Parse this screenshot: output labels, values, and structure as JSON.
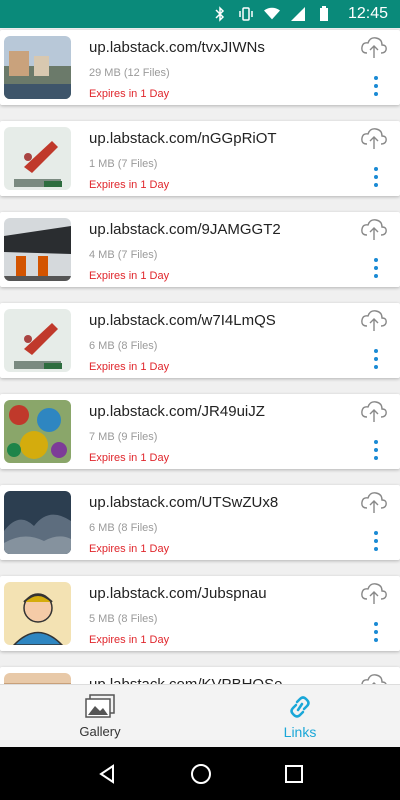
{
  "status": {
    "time": "12:45"
  },
  "links": [
    {
      "url": "up.labstack.com/tvxJIWNs",
      "meta": "29 MB (12 Files)",
      "expires": "Expires in 1 Day"
    },
    {
      "url": "up.labstack.com/nGGpRiOT",
      "meta": "1 MB (7 Files)",
      "expires": "Expires in 1 Day"
    },
    {
      "url": "up.labstack.com/9JAMGGT2",
      "meta": "4 MB (7 Files)",
      "expires": "Expires in 1 Day"
    },
    {
      "url": "up.labstack.com/w7I4LmQS",
      "meta": "6 MB (8 Files)",
      "expires": "Expires in 1 Day"
    },
    {
      "url": "up.labstack.com/JR49uiJZ",
      "meta": "7 MB (9 Files)",
      "expires": "Expires in 1 Day"
    },
    {
      "url": "up.labstack.com/UTSwZUx8",
      "meta": "6 MB (8 Files)",
      "expires": "Expires in 1 Day"
    },
    {
      "url": "up.labstack.com/Jubspnau",
      "meta": "5 MB (8 Files)",
      "expires": "Expires in 1 Day"
    },
    {
      "url": "up.labstack.com/KVPBHQSe",
      "meta": "",
      "expires": ""
    }
  ],
  "nav": {
    "gallery": "Gallery",
    "links": "Links"
  },
  "colors": {
    "accent": "#1aa7d8",
    "expire": "#e0262c",
    "statusbar": "#0a8a7a"
  }
}
